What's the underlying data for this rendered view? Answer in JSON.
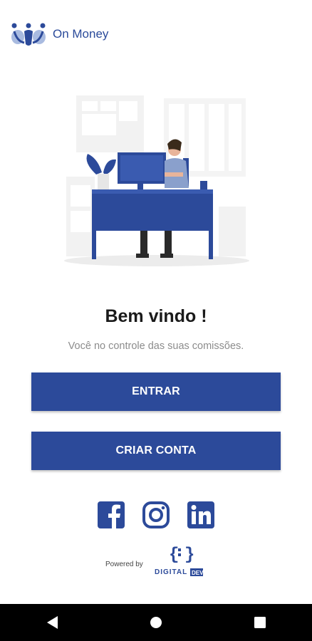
{
  "app": {
    "name": "On Money"
  },
  "welcome": {
    "title": "Bem vindo !",
    "subtitle": "Você no controle das suas comissões."
  },
  "buttons": {
    "enter_label": "ENTRAR",
    "create_label": "CRIAR CONTA"
  },
  "social": {
    "icons": [
      "facebook-icon",
      "instagram-icon",
      "linkedin-icon"
    ]
  },
  "footer": {
    "powered_by": "Powered by",
    "brand_word1": "DIGITAL",
    "brand_word2": "DEV"
  },
  "colors": {
    "primary": "#2c4a9a",
    "brand_text": "#2a4a9a",
    "subtitle": "#8c8c8c",
    "navbar": "#000000"
  }
}
